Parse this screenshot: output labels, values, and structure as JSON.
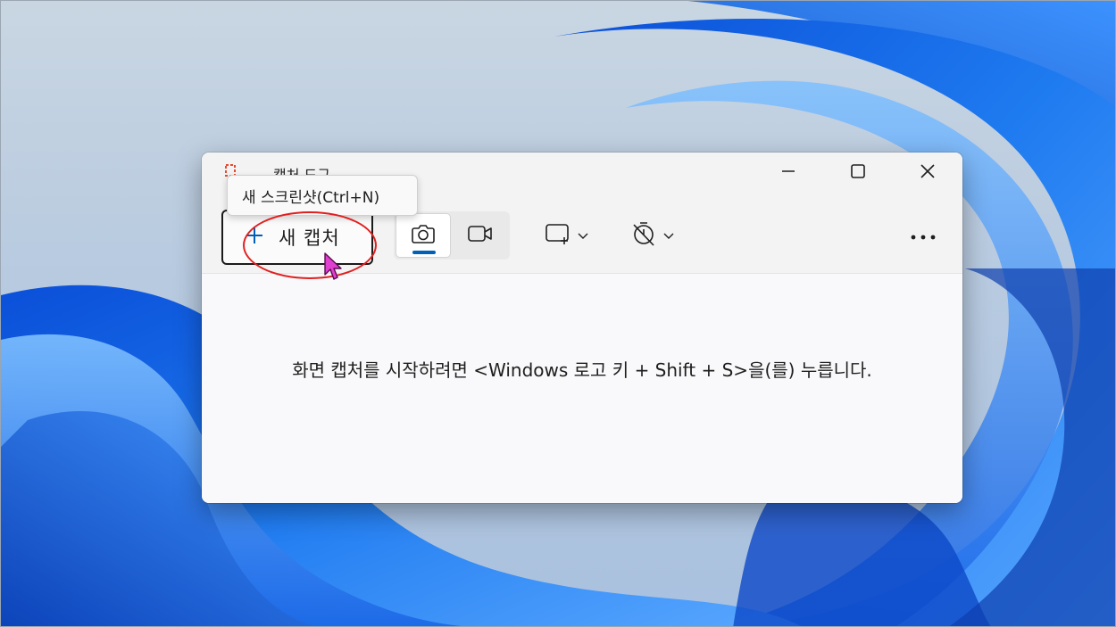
{
  "window": {
    "app_title": "캡처 도구",
    "minimize_label": "",
    "maximize_label": "",
    "close_label": ""
  },
  "toolbar": {
    "new_capture_label": "새 캡처",
    "icons": {
      "add": "plus-icon",
      "photo_mode": "camera-icon",
      "video_mode": "video-camera-icon",
      "snip_shape": "rectangle-snip-icon",
      "delay": "timer-off-icon",
      "more": "more-dots-icon"
    }
  },
  "tooltip": {
    "text": "새 스크린샷(Ctrl+N)"
  },
  "content": {
    "hint_text": "화면 캡처를 시작하려면 <Windows 로고 키 + Shift + S>을(를) 누릅니다."
  },
  "colors": {
    "accent": "#005fb8",
    "highlight_ring": "#e02020",
    "cursor": "#e040d0"
  }
}
